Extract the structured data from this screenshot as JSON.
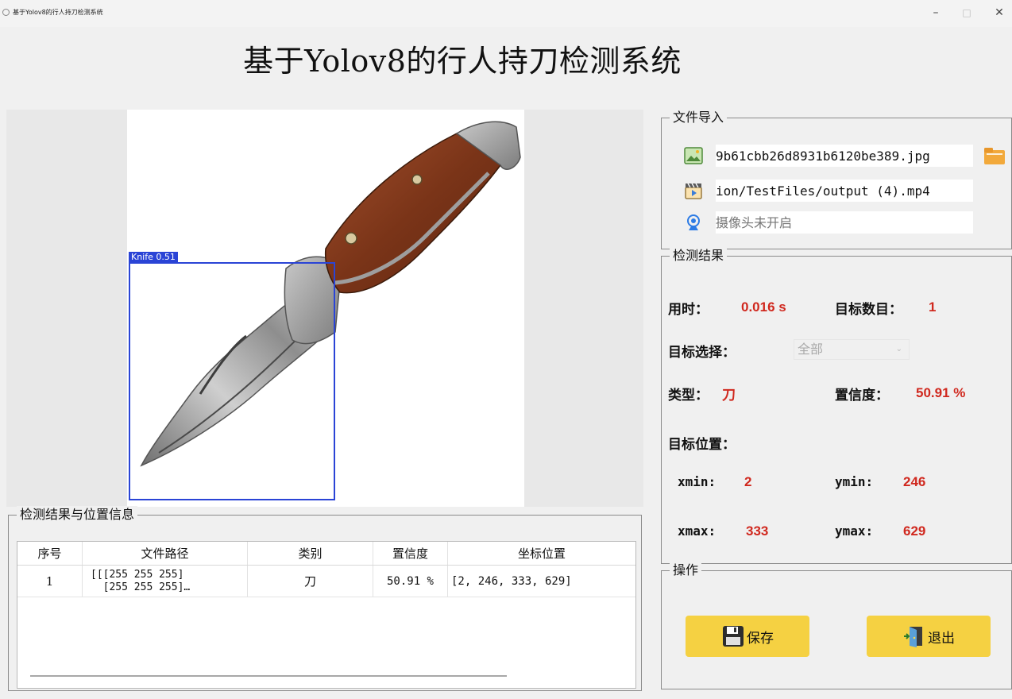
{
  "window": {
    "title": "基于Yolov8的行人持刀检测系统",
    "minimize": "–",
    "maximize": "□",
    "close": "✕"
  },
  "main_title": "基于Yolov8的行人持刀检测系统",
  "image_view": {
    "detection_label": "Knife 0.51",
    "box_color": "#2a44d6"
  },
  "results_table": {
    "group_title": "检测结果与位置信息",
    "columns": [
      "序号",
      "文件路径",
      "类别",
      "置信度",
      "坐标位置"
    ],
    "rows": [
      {
        "index": "1",
        "path": "[[[255 255 255]\n  [255 255 255]…",
        "class": "刀",
        "confidence": "50.91 %",
        "coords": "[2, 246, 333, 629]"
      }
    ]
  },
  "file_import": {
    "group_title": "文件导入",
    "image_path": "9b61cbb26d8931b6120be389.jpg",
    "video_path": "ion/TestFiles/output (4).mp4",
    "camera_status": "摄像头未开启"
  },
  "detection": {
    "group_title": "检测结果",
    "time_label": "用时：",
    "time_value": "0.016 s",
    "count_label": "目标数目：",
    "count_value": "1",
    "select_label": "目标选择：",
    "select_value": "全部",
    "type_label": "类型：",
    "type_value": "刀",
    "conf_label": "置信度：",
    "conf_value": "50.91 %",
    "position_label": "目标位置：",
    "xmin_label": "xmin:",
    "xmin_value": "2",
    "ymin_label": "ymin:",
    "ymin_value": "246",
    "xmax_label": "xmax:",
    "xmax_value": "333",
    "ymax_label": "ymax:",
    "ymax_value": "629",
    "value_color": "#d0281e"
  },
  "operations": {
    "group_title": "操作",
    "save_label": "保存",
    "exit_label": "退出",
    "button_color": "#f5d142"
  }
}
